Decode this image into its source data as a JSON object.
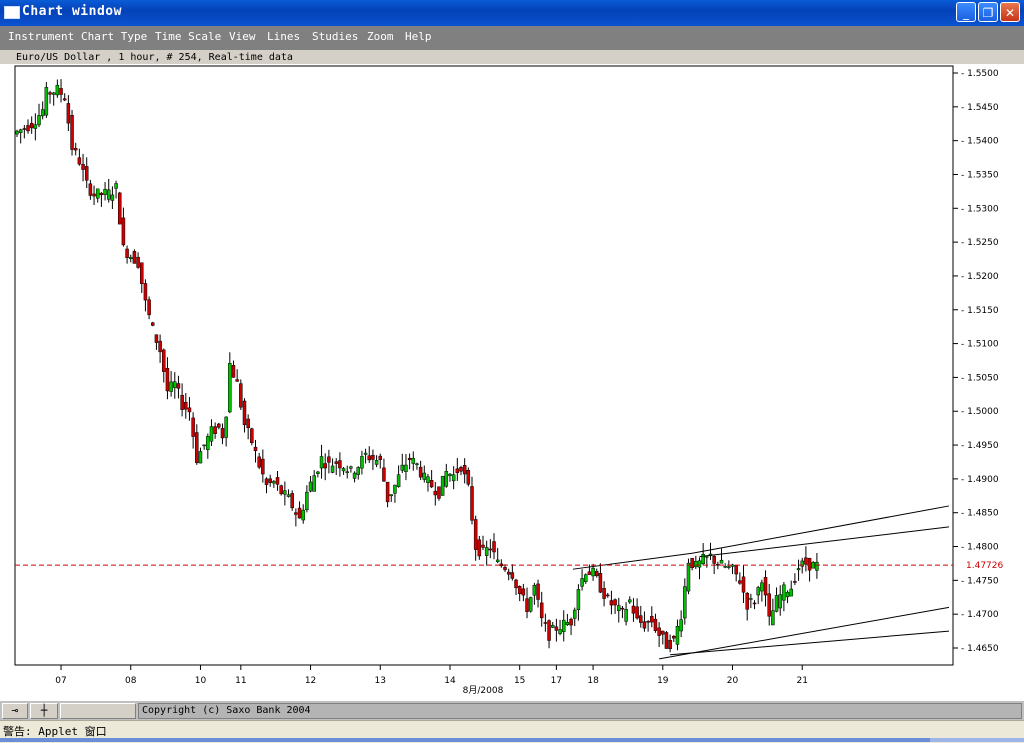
{
  "window": {
    "title": "Chart window",
    "minimize_label": "_",
    "restore_label": "❐",
    "close_label": "✕"
  },
  "menu": [
    "Instrument",
    "Chart Type",
    "Time Scale",
    "View",
    "Lines",
    "Studies",
    "Zoom",
    "Help"
  ],
  "chart_header": "Euro/US Dollar , 1 hour, # 254, Real-time data",
  "bottombar": {
    "copyright": "Copyright (c) Saxo Bank 2004",
    "nav_left_icon": "pin-icon",
    "nav_right_icon": "crosshair-icon"
  },
  "status": {
    "text": "警告: Applet 窗口"
  },
  "colors": {
    "up": "#00c000",
    "down": "#cc0000",
    "current_price_line": "#cc0000",
    "background": "#ffffff"
  },
  "chart_data": {
    "type": "candlestick",
    "title": "Euro/US Dollar , 1 hour, # 254, Real-time data",
    "y_ticks": [
      "1.5500",
      "1.5450",
      "1.5400",
      "1.5350",
      "1.5300",
      "1.5250",
      "1.5200",
      "1.5150",
      "1.5100",
      "1.5050",
      "1.5000",
      "1.4950",
      "1.4900",
      "1.4850",
      "1.4800",
      "1.4750",
      "1.4700",
      "1.4650"
    ],
    "ylim": [
      1.4625,
      1.5515
    ],
    "current_price": "1.47726",
    "x_ticks": [
      "07",
      "08",
      "10",
      "11",
      "12",
      "13",
      "14",
      "15",
      "17",
      "18",
      "19",
      "20",
      "21"
    ],
    "x_axis_month_label": "8月/2008",
    "path_points": [
      [
        0,
        1.541
      ],
      [
        5,
        1.5425
      ],
      [
        8,
        1.5445
      ],
      [
        9,
        1.547
      ],
      [
        12,
        1.5475
      ],
      [
        14,
        1.5465
      ],
      [
        16,
        1.539
      ],
      [
        18,
        1.537
      ],
      [
        20,
        1.5335
      ],
      [
        22,
        1.532
      ],
      [
        26,
        1.5322
      ],
      [
        28,
        1.533
      ],
      [
        30,
        1.524
      ],
      [
        32,
        1.523
      ],
      [
        34,
        1.522
      ],
      [
        36,
        1.516
      ],
      [
        38,
        1.512
      ],
      [
        40,
        1.509
      ],
      [
        42,
        1.503
      ],
      [
        44,
        1.504
      ],
      [
        46,
        1.501
      ],
      [
        48,
        1.5
      ],
      [
        50,
        1.493
      ],
      [
        52,
        1.495
      ],
      [
        54,
        1.497
      ],
      [
        56,
        1.4975
      ],
      [
        57,
        1.4965
      ],
      [
        58,
        1.5
      ],
      [
        59,
        1.507
      ],
      [
        61,
        1.504
      ],
      [
        63,
        1.498
      ],
      [
        65,
        1.4955
      ],
      [
        67,
        1.492
      ],
      [
        69,
        1.489
      ],
      [
        71,
        1.4895
      ],
      [
        73,
        1.488
      ],
      [
        75,
        1.487
      ],
      [
        77,
        1.485
      ],
      [
        78,
        1.484
      ],
      [
        80,
        1.488
      ],
      [
        82,
        1.4905
      ],
      [
        84,
        1.493
      ],
      [
        86,
        1.492
      ],
      [
        88,
        1.4925
      ],
      [
        90,
        1.492
      ],
      [
        92,
        1.491
      ],
      [
        94,
        1.492
      ],
      [
        96,
        1.4935
      ],
      [
        98,
        1.493
      ],
      [
        100,
        1.4925
      ],
      [
        102,
        1.487
      ],
      [
        104,
        1.489
      ],
      [
        106,
        1.4915
      ],
      [
        108,
        1.493
      ],
      [
        110,
        1.492
      ],
      [
        112,
        1.49
      ],
      [
        114,
        1.489
      ],
      [
        116,
        1.488
      ],
      [
        118,
        1.491
      ],
      [
        120,
        1.4905
      ],
      [
        122,
        1.492
      ],
      [
        124,
        1.4885
      ],
      [
        126,
        1.48
      ],
      [
        128,
        1.479
      ],
      [
        130,
        1.48
      ],
      [
        132,
        1.4775
      ],
      [
        134,
        1.477
      ],
      [
        136,
        1.476
      ],
      [
        138,
        1.473
      ],
      [
        140,
        1.471
      ],
      [
        142,
        1.474
      ],
      [
        144,
        1.469
      ],
      [
        146,
        1.467
      ],
      [
        148,
        1.468
      ],
      [
        150,
        1.4685
      ],
      [
        152,
        1.469
      ],
      [
        154,
        1.474
      ],
      [
        156,
        1.4765
      ],
      [
        158,
        1.476
      ],
      [
        160,
        1.474
      ],
      [
        162,
        1.472
      ],
      [
        164,
        1.471
      ],
      [
        166,
        1.47
      ],
      [
        168,
        1.472
      ],
      [
        170,
        1.469
      ],
      [
        172,
        1.4685
      ],
      [
        174,
        1.469
      ],
      [
        176,
        1.467
      ],
      [
        178,
        1.4655
      ],
      [
        180,
        1.466
      ],
      [
        182,
        1.47
      ],
      [
        184,
        1.478
      ],
      [
        186,
        1.477
      ],
      [
        188,
        1.478
      ],
      [
        190,
        1.4785
      ],
      [
        192,
        1.4775
      ],
      [
        194,
        1.477
      ],
      [
        196,
        1.4765
      ],
      [
        198,
        1.475
      ],
      [
        200,
        1.4715
      ],
      [
        202,
        1.472
      ],
      [
        204,
        1.4755
      ],
      [
        206,
        1.469
      ],
      [
        208,
        1.472
      ],
      [
        210,
        1.4735
      ],
      [
        212,
        1.474
      ],
      [
        214,
        1.477
      ],
      [
        216,
        1.4775
      ],
      [
        218,
        1.4772
      ]
    ],
    "x_index_max": 254,
    "trend_lines": [
      {
        "from": [
          151.5,
          1.47665
        ],
        "to": [
          184,
          1.479
        ]
      },
      {
        "from": [
          184,
          1.479
        ],
        "to": [
          254,
          1.486
        ]
      },
      {
        "from": [
          186,
          1.4785
        ],
        "to": [
          254,
          1.4829
        ]
      },
      {
        "from": [
          175,
          1.4634
        ],
        "to": [
          254,
          1.471
        ]
      },
      {
        "from": [
          178,
          1.464
        ],
        "to": [
          254,
          1.4675
        ]
      }
    ]
  }
}
